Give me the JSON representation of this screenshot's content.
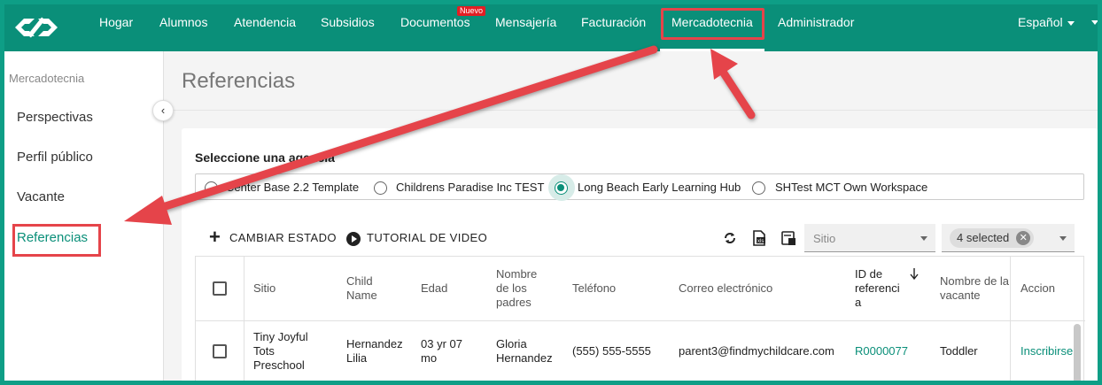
{
  "colors": {
    "brand": "#0a8f79",
    "annotation": "#e5444a",
    "badge": "#e31e24"
  },
  "nav": {
    "items": [
      "Hogar",
      "Alumnos",
      "Atendencia",
      "Subsidios",
      "Documentos",
      "Mensajería",
      "Facturación",
      "Mercadotecnia",
      "Administrador"
    ],
    "new_badge": "Nuevo",
    "active": "Mercadotecnia",
    "language": "Español"
  },
  "sidebar": {
    "title": "Mercadotecnia",
    "items": [
      "Perspectivas",
      "Perfil público",
      "Vacante",
      "Referencias"
    ],
    "active": "Referencias"
  },
  "page": {
    "title": "Referencias"
  },
  "agency": {
    "label": "Seleccione una agencia",
    "options": [
      {
        "label": "Center Base 2.2 Template",
        "checked": false
      },
      {
        "label": "Childrens Paradise Inc TEST",
        "checked": false
      },
      {
        "label": "Long Beach Early Learning Hub",
        "checked": true
      },
      {
        "label": "SHTest MCT Own Workspace",
        "checked": false
      }
    ]
  },
  "toolbar": {
    "change_status": "CAMBIAR ESTADO",
    "video_tutorial": "TUTORIAL DE VIDEO",
    "site_placeholder": "Sitio",
    "status_selected": "4 selected",
    "icons": [
      "refresh-icon",
      "export-excel-icon",
      "print-icon"
    ]
  },
  "table": {
    "headers": {
      "site": "Sitio",
      "child_name": "Child\nName",
      "age": "Edad",
      "parents": "Nombre\nde los\npadres",
      "phone": "Teléfono",
      "email": "Correo electrónico",
      "referral_id": "ID de\nreferenci\na",
      "vacancy": "Nombre de la\nvacante",
      "action": "Accion"
    },
    "rows": [
      {
        "site": "Tiny Joyful\nTots\nPreschool",
        "child_name": "Hernandez\nLilia",
        "age": "03 yr 07\nmo",
        "parents": "Gloria\nHernandez",
        "phone": "(555) 555-5555",
        "email": "parent3@findmychildcare.com",
        "referral_id": "R0000077",
        "vacancy": "Toddler",
        "action": "Inscribirse"
      }
    ]
  }
}
